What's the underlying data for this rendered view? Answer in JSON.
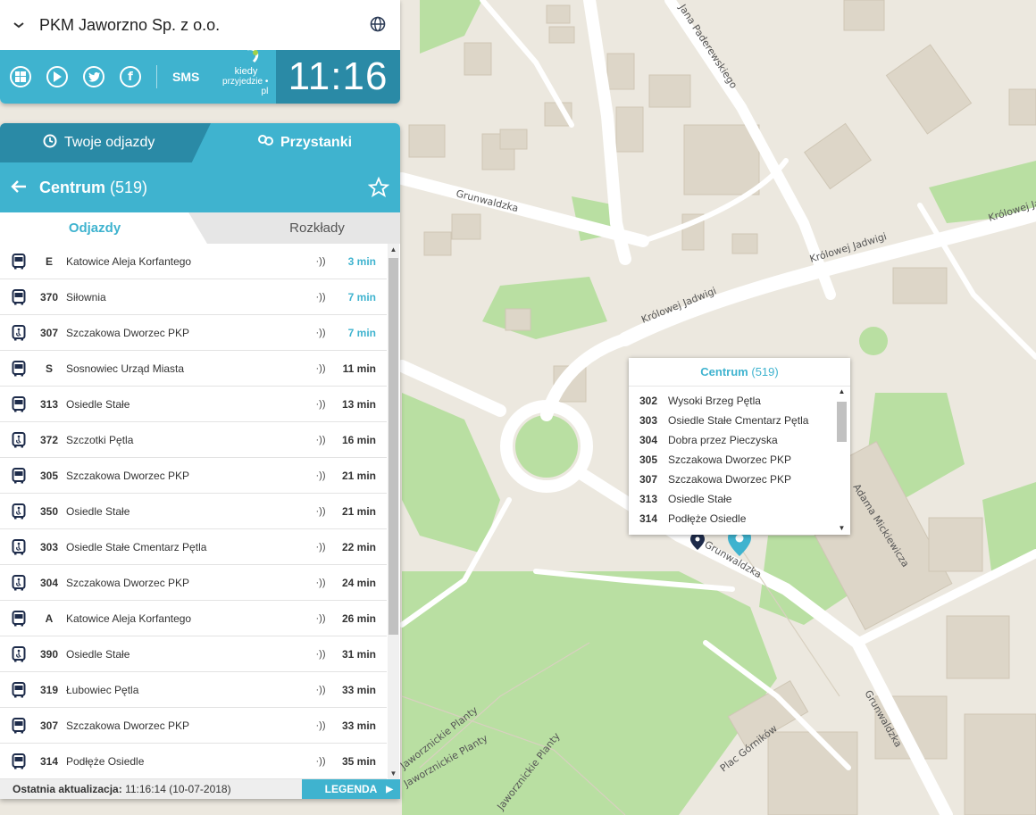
{
  "header": {
    "operator": "PKM Jaworzno Sp. z o.o.",
    "sms_label": "SMS",
    "logo_text_top": "kiedy",
    "logo_text_bottom": "przyjedzie",
    "logo_text_suffix": "pl",
    "clock": "11:16"
  },
  "tabs": {
    "departures": "Twoje odjazdy",
    "stops": "Przystanki"
  },
  "stop": {
    "name": "Centrum",
    "code": "(519)"
  },
  "subtabs": {
    "departures": "Odjazdy",
    "timetables": "Rozkłady"
  },
  "departures": [
    {
      "line": "E",
      "destination": "Katowice Aleja Korfantego",
      "time": "3 min",
      "soon": true,
      "vehicle": "bus"
    },
    {
      "line": "370",
      "destination": "Siłownia",
      "time": "7 min",
      "soon": true,
      "vehicle": "bus"
    },
    {
      "line": "307",
      "destination": "Szczakowa Dworzec PKP",
      "time": "7 min",
      "soon": true,
      "vehicle": "bus-accessible"
    },
    {
      "line": "S",
      "destination": "Sosnowiec Urząd Miasta",
      "time": "11 min",
      "soon": false,
      "vehicle": "bus"
    },
    {
      "line": "313",
      "destination": "Osiedle Stałe",
      "time": "13 min",
      "soon": false,
      "vehicle": "bus"
    },
    {
      "line": "372",
      "destination": "Szczotki Pętla",
      "time": "16 min",
      "soon": false,
      "vehicle": "bus-accessible"
    },
    {
      "line": "305",
      "destination": "Szczakowa Dworzec PKP",
      "time": "21 min",
      "soon": false,
      "vehicle": "bus"
    },
    {
      "line": "350",
      "destination": "Osiedle Stałe",
      "time": "21 min",
      "soon": false,
      "vehicle": "bus-accessible"
    },
    {
      "line": "303",
      "destination": "Osiedle Stałe Cmentarz Pętla",
      "time": "22 min",
      "soon": false,
      "vehicle": "bus-accessible"
    },
    {
      "line": "304",
      "destination": "Szczakowa Dworzec PKP",
      "time": "24 min",
      "soon": false,
      "vehicle": "bus-accessible"
    },
    {
      "line": "A",
      "destination": "Katowice Aleja Korfantego",
      "time": "26 min",
      "soon": false,
      "vehicle": "bus"
    },
    {
      "line": "390",
      "destination": "Osiedle Stałe",
      "time": "31 min",
      "soon": false,
      "vehicle": "bus-accessible"
    },
    {
      "line": "319",
      "destination": "Łubowiec Pętla",
      "time": "33 min",
      "soon": false,
      "vehicle": "bus"
    },
    {
      "line": "307",
      "destination": "Szczakowa Dworzec PKP",
      "time": "33 min",
      "soon": false,
      "vehicle": "bus"
    },
    {
      "line": "314",
      "destination": "Podłęże Osiedle",
      "time": "35 min",
      "soon": false,
      "vehicle": "bus"
    }
  ],
  "footer": {
    "update_label": "Ostatnia aktualizacja:",
    "update_value": "11:16:14 (10-07-2018)",
    "legend": "LEGENDA"
  },
  "popup": {
    "title": "Centrum",
    "code": "(519)",
    "lines": [
      {
        "line": "302",
        "destination": "Wysoki Brzeg Pętla"
      },
      {
        "line": "303",
        "destination": "Osiedle Stałe Cmentarz Pętla"
      },
      {
        "line": "304",
        "destination": "Dobra przez Pieczyska"
      },
      {
        "line": "305",
        "destination": "Szczakowa Dworzec PKP"
      },
      {
        "line": "307",
        "destination": "Szczakowa Dworzec PKP"
      },
      {
        "line": "313",
        "destination": "Osiedle Stałe"
      },
      {
        "line": "314",
        "destination": "Podłęże Osiedle"
      }
    ]
  },
  "map_labels": {
    "grunwaldzka_1": "Grunwaldzka",
    "grunwaldzka_2": "Grunwaldzka",
    "grunwaldzka_3": "Grunwaldzka",
    "krolowej_1": "Królowej Jadwigi",
    "krolowej_2": "Królowej Jadwigi",
    "krolowej_3": "Królowej Jadwigi",
    "paderewskiego": "Jana Paderewskiego",
    "mickiewicza": "Adama Mickiewicza",
    "plac": "Plac Górników",
    "planty_1": "Jaworznickie Planty",
    "planty_2": "Jaworznickie Planty",
    "planty_3": "Jaworznickie Planty"
  },
  "colors": {
    "accent": "#3fb3cf",
    "accent_dark": "#2a8aa6",
    "map_bg": "#ece8df",
    "park": "#b9dfa2",
    "road": "#ffffff"
  }
}
